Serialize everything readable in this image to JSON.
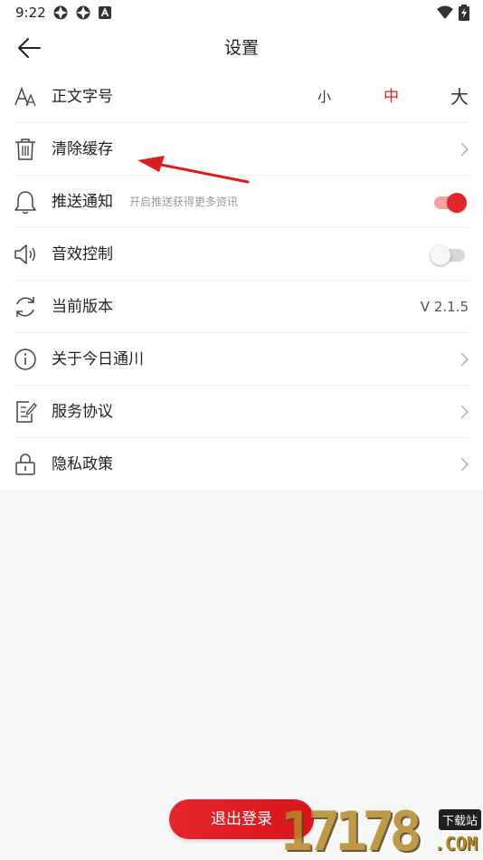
{
  "status_bar": {
    "time": "9:22",
    "icons": [
      "notification-app-icon",
      "notification-app-icon",
      "a-badge-icon",
      "wifi-icon",
      "battery-charging-icon"
    ]
  },
  "header": {
    "title": "设置",
    "back_icon": "arrow-left-icon"
  },
  "settings": {
    "font_size": {
      "label": "正文字号",
      "icon": "font-size-icon",
      "options": [
        "小",
        "中",
        "大"
      ],
      "selected": "中"
    },
    "clear_cache": {
      "label": "清除缓存",
      "icon": "trash-icon"
    },
    "push": {
      "label": "推送通知",
      "hint": "开启推送获得更多资讯",
      "icon": "bell-icon",
      "enabled": true
    },
    "sound": {
      "label": "音效控制",
      "icon": "speaker-icon",
      "enabled": false
    },
    "version": {
      "label": "当前版本",
      "value": "V 2.1.5",
      "icon": "refresh-icon"
    },
    "about": {
      "label": "关于今日通川",
      "icon": "info-icon"
    },
    "agreement": {
      "label": "服务协议",
      "icon": "document-edit-icon"
    },
    "privacy": {
      "label": "隐私政策",
      "icon": "lock-icon"
    }
  },
  "logout": {
    "label": "退出登录"
  },
  "watermark": {
    "digits": "17178",
    "badge": "下载站",
    "suffix": ".COM"
  },
  "colors": {
    "accent": "#e0262a",
    "toggle_on_track": "#f3a3a3",
    "background": "#f7f7f7"
  }
}
